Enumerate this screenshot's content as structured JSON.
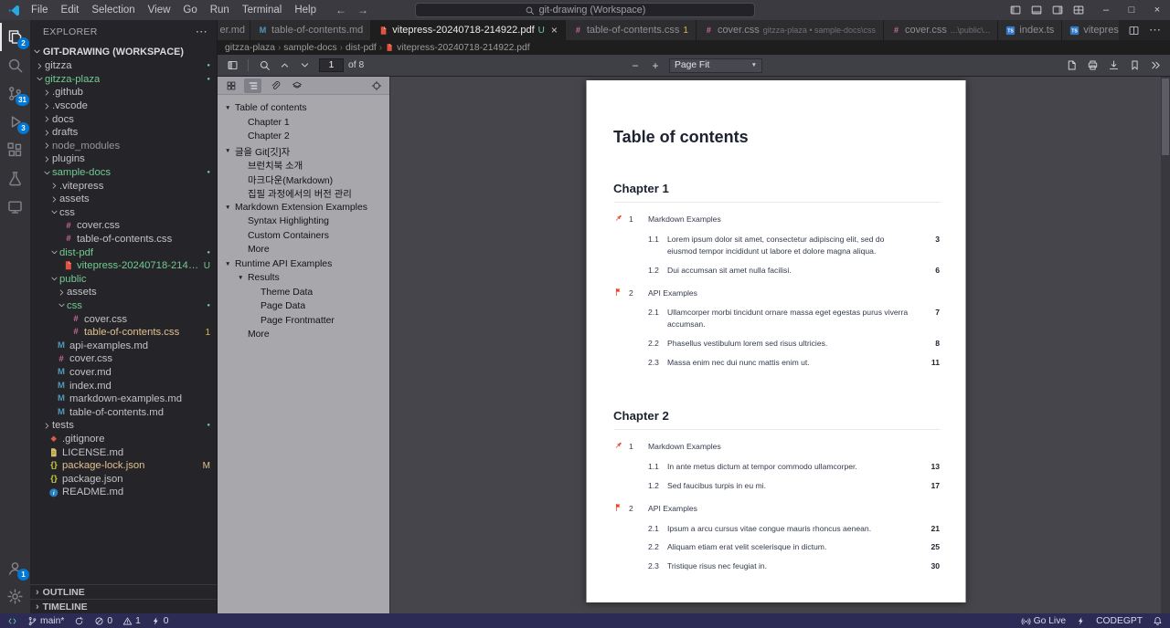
{
  "glyphs": {
    "ellipsis": "⋯",
    "close": "×",
    "minus": "−",
    "plus": "+",
    "back": "←",
    "forward": "→",
    "maximize": "□",
    "minimize": "–",
    "tri_down": "▼",
    "crumb_sep": "›",
    "dot": "●"
  },
  "colors": {
    "accent": "#0078d4",
    "untracked": "#73c991",
    "modified": "#e2c08d",
    "warning": "#d7ba4d",
    "pdf_red": "#e25241"
  },
  "title_bar": {
    "menus": [
      "File",
      "Edit",
      "Selection",
      "View",
      "Go",
      "Run",
      "Terminal",
      "Help"
    ],
    "search_text": "git-drawing (Workspace)"
  },
  "activity_bar": {
    "top": [
      {
        "id": "explorer",
        "icon": "files-icon",
        "active": true,
        "badge": "2"
      },
      {
        "id": "search",
        "icon": "search-icon"
      },
      {
        "id": "source-control",
        "icon": "source-control-icon",
        "badge": "31"
      },
      {
        "id": "run-and-debug",
        "icon": "debug-icon",
        "badge": "3"
      },
      {
        "id": "extensions",
        "icon": "extensions-icon"
      },
      {
        "id": "testing",
        "icon": "beaker-icon"
      },
      {
        "id": "remote-explorer",
        "icon": "remote-window-icon"
      }
    ],
    "bottom": [
      {
        "id": "accounts",
        "icon": "account-icon",
        "badge": "1"
      },
      {
        "id": "settings",
        "icon": "gear-icon"
      }
    ]
  },
  "explorer": {
    "title": "EXPLORER",
    "workspace_label": "GIT-DRAWING (WORKSPACE)",
    "tree": [
      {
        "label": "gitzza",
        "kind": "folder",
        "level": 0,
        "expanded": false,
        "badge": "dot"
      },
      {
        "label": "gitzza-plaza",
        "kind": "folder",
        "level": 0,
        "expanded": true,
        "color": "untracked",
        "badge": "dot"
      },
      {
        "label": ".github",
        "kind": "folder",
        "level": 1,
        "expanded": false
      },
      {
        "label": ".vscode",
        "kind": "folder",
        "level": 1,
        "expanded": false
      },
      {
        "label": "docs",
        "kind": "folder",
        "level": 1,
        "expanded": false
      },
      {
        "label": "drafts",
        "kind": "folder",
        "level": 1,
        "expanded": false
      },
      {
        "label": "node_modules",
        "kind": "folder",
        "level": 1,
        "expanded": false,
        "color": "dim"
      },
      {
        "label": "plugins",
        "kind": "folder",
        "level": 1,
        "expanded": false
      },
      {
        "label": "sample-docs",
        "kind": "folder",
        "level": 1,
        "expanded": true,
        "color": "untracked",
        "badge": "dot"
      },
      {
        "label": ".vitepress",
        "kind": "folder",
        "level": 2,
        "expanded": false
      },
      {
        "label": "assets",
        "kind": "folder",
        "level": 2,
        "expanded": false
      },
      {
        "label": "css",
        "kind": "folder",
        "level": 2,
        "expanded": true
      },
      {
        "label": "cover.css",
        "kind": "file",
        "icon": "css-icon",
        "level": 3
      },
      {
        "label": "table-of-contents.css",
        "kind": "file",
        "icon": "css-icon",
        "level": 3
      },
      {
        "label": "dist-pdf",
        "kind": "folder",
        "level": 2,
        "expanded": true,
        "color": "untracked",
        "badge": "dot"
      },
      {
        "label": "vitepress-20240718-214922.pdf",
        "kind": "file",
        "icon": "pdf-icon",
        "level": 3,
        "color": "untracked",
        "badge": "U",
        "badge_style": "b-untracked"
      },
      {
        "label": "public",
        "kind": "folder",
        "level": 2,
        "expanded": true,
        "color": "untracked"
      },
      {
        "label": "assets",
        "kind": "folder",
        "level": 3,
        "expanded": false
      },
      {
        "label": "css",
        "kind": "folder",
        "level": 3,
        "expanded": true,
        "color": "untracked",
        "badge": "dot"
      },
      {
        "label": "cover.css",
        "kind": "file",
        "icon": "css-icon",
        "level": 4
      },
      {
        "label": "table-of-contents.css",
        "kind": "file",
        "icon": "css-icon",
        "level": 4,
        "color": "modified",
        "badge": "1",
        "badge_style": "b-warning"
      },
      {
        "label": "api-examples.md",
        "kind": "file",
        "icon": "md-icon",
        "level": 2
      },
      {
        "label": "cover.css",
        "kind": "file",
        "icon": "css-icon",
        "level": 2
      },
      {
        "label": "cover.md",
        "kind": "file",
        "icon": "md-icon",
        "level": 2
      },
      {
        "label": "index.md",
        "kind": "file",
        "icon": "md-icon",
        "level": 2
      },
      {
        "label": "markdown-examples.md",
        "kind": "file",
        "icon": "md-icon",
        "level": 2
      },
      {
        "label": "table-of-contents.md",
        "kind": "file",
        "icon": "md-icon",
        "level": 2
      },
      {
        "label": "tests",
        "kind": "folder",
        "level": 1,
        "expanded": false,
        "badge": "dot"
      },
      {
        "label": ".gitignore",
        "kind": "file",
        "icon": "git-icon",
        "level": 1
      },
      {
        "label": "LICENSE.md",
        "kind": "file",
        "icon": "license-icon",
        "level": 1
      },
      {
        "label": "package-lock.json",
        "kind": "file",
        "icon": "json-icon",
        "level": 1,
        "color": "modified",
        "badge": "M",
        "badge_style": "b-modified"
      },
      {
        "label": "package.json",
        "kind": "file",
        "icon": "json-icon",
        "level": 1
      },
      {
        "label": "README.md",
        "kind": "file",
        "icon": "info-icon",
        "level": 1
      }
    ],
    "footer_sections": [
      "OUTLINE",
      "TIMELINE"
    ]
  },
  "tabs": [
    {
      "label": "er.md",
      "partial": true
    },
    {
      "label": "table-of-contents.md",
      "icon": "md-icon"
    },
    {
      "label": "vitepress-20240718-214922.pdf",
      "icon": "pdf-icon",
      "active": true,
      "badge": "U",
      "badge_style": "b-untracked",
      "closable": true
    },
    {
      "label": "table-of-contents.css",
      "icon": "css-icon",
      "badge": "1",
      "badge_style": "b-warning"
    },
    {
      "label": "cover.css",
      "icon": "css-icon",
      "description": "gitzza-plaza • sample-docs\\css"
    },
    {
      "label": "cover.css",
      "icon": "css-icon",
      "description": "...\\public\\..."
    },
    {
      "label": "index.ts",
      "icon": "ts-icon"
    },
    {
      "label": "vitepress-pdf.config.ts",
      "icon": "ts-icon"
    }
  ],
  "breadcrumb": {
    "items": [
      "gitzza-plaza",
      "sample-docs",
      "dist-pdf",
      "vitepress-20240718-214922.pdf"
    ],
    "last_icon": "pdf-icon"
  },
  "pdf_toolbar": {
    "page_value": "1",
    "page_count_label": "of 8",
    "zoom_value": "Page Fit"
  },
  "pdf_outline": [
    {
      "label": "Table of contents",
      "level": 0,
      "expandable": true
    },
    {
      "label": "Chapter 1",
      "level": 1
    },
    {
      "label": "Chapter 2",
      "level": 1
    },
    {
      "label": "글을 Git[깃]자",
      "level": 0,
      "expandable": true
    },
    {
      "label": "브런치북 소개",
      "level": 1
    },
    {
      "label": "마크다운(Markdown)",
      "level": 1
    },
    {
      "label": "집필 과정에서의 버전 관리",
      "level": 1
    },
    {
      "label": "Markdown Extension Examples",
      "level": 0,
      "expandable": true
    },
    {
      "label": "Syntax Highlighting",
      "level": 1
    },
    {
      "label": "Custom Containers",
      "level": 1
    },
    {
      "label": "More",
      "level": 1
    },
    {
      "label": "Runtime API Examples",
      "level": 0,
      "expandable": true
    },
    {
      "label": "Results",
      "level": 1,
      "expandable": true
    },
    {
      "label": "Theme Data",
      "level": 2
    },
    {
      "label": "Page Data",
      "level": 2
    },
    {
      "label": "Page Frontmatter",
      "level": 2
    },
    {
      "label": "More",
      "level": 1
    }
  ],
  "pdf_page": {
    "title": "Table of contents",
    "chapters": [
      {
        "heading": "Chapter 1",
        "entries": [
          {
            "level": 1,
            "icon": "pin-icon",
            "num": "1",
            "text": "Markdown Examples",
            "page": ""
          },
          {
            "level": 2,
            "num": "1.1",
            "text": "Lorem ipsum dolor sit amet, consectetur adipiscing elit, sed do eiusmod tempor incididunt ut labore et dolore magna aliqua.",
            "page": "3"
          },
          {
            "level": 2,
            "num": "1.2",
            "text": "Dui accumsan sit amet nulla facilisi.",
            "page": "6"
          },
          {
            "level": 1,
            "icon": "flag-icon",
            "num": "2",
            "text": "API Examples",
            "page": ""
          },
          {
            "level": 2,
            "num": "2.1",
            "text": "Ullamcorper morbi tincidunt ornare massa eget egestas purus viverra accumsan.",
            "page": "7"
          },
          {
            "level": 2,
            "num": "2.2",
            "text": "Phasellus vestibulum lorem sed risus ultricies.",
            "page": "8"
          },
          {
            "level": 2,
            "num": "2.3",
            "text": "Massa enim nec dui nunc mattis enim ut.",
            "page": "11"
          }
        ]
      },
      {
        "heading": "Chapter 2",
        "entries": [
          {
            "level": 1,
            "icon": "pin-icon",
            "num": "1",
            "text": "Markdown Examples",
            "page": ""
          },
          {
            "level": 2,
            "num": "1.1",
            "text": "In ante metus dictum at tempor commodo ullamcorper.",
            "page": "13"
          },
          {
            "level": 2,
            "num": "1.2",
            "text": "Sed faucibus turpis in eu mi.",
            "page": "17"
          },
          {
            "level": 1,
            "icon": "flag-icon",
            "num": "2",
            "text": "API Examples",
            "page": ""
          },
          {
            "level": 2,
            "num": "2.1",
            "text": "Ipsum a arcu cursus vitae congue mauris rhoncus aenean.",
            "page": "21"
          },
          {
            "level": 2,
            "num": "2.2",
            "text": "Aliquam etiam erat velit scelerisque in dictum.",
            "page": "25"
          },
          {
            "level": 2,
            "num": "2.3",
            "text": "Tristique risus nec feugiat in.",
            "page": "30"
          }
        ]
      }
    ]
  },
  "status_bar": {
    "left": [
      {
        "name": "remote-indicator",
        "icon": "remote-status-icon",
        "color": "#6fd3a4"
      },
      {
        "name": "git-branch",
        "icon": "branch-icon",
        "text": "main*"
      },
      {
        "name": "sync",
        "icon": "sync-icon"
      },
      {
        "name": "errors",
        "icon": "error-icon",
        "text": "0"
      },
      {
        "name": "warnings",
        "icon": "warning-icon",
        "text": "1"
      },
      {
        "name": "ports",
        "icon": "bolt-icon",
        "text": "0"
      }
    ],
    "right": [
      {
        "name": "go-live",
        "icon": "broadcast-icon",
        "text": "Go Live"
      },
      {
        "name": "codegpt-action",
        "icon": "bolt-icon"
      },
      {
        "name": "codegpt",
        "text": "CODEGPT"
      },
      {
        "name": "notifications",
        "icon": "bell-icon"
      }
    ]
  }
}
